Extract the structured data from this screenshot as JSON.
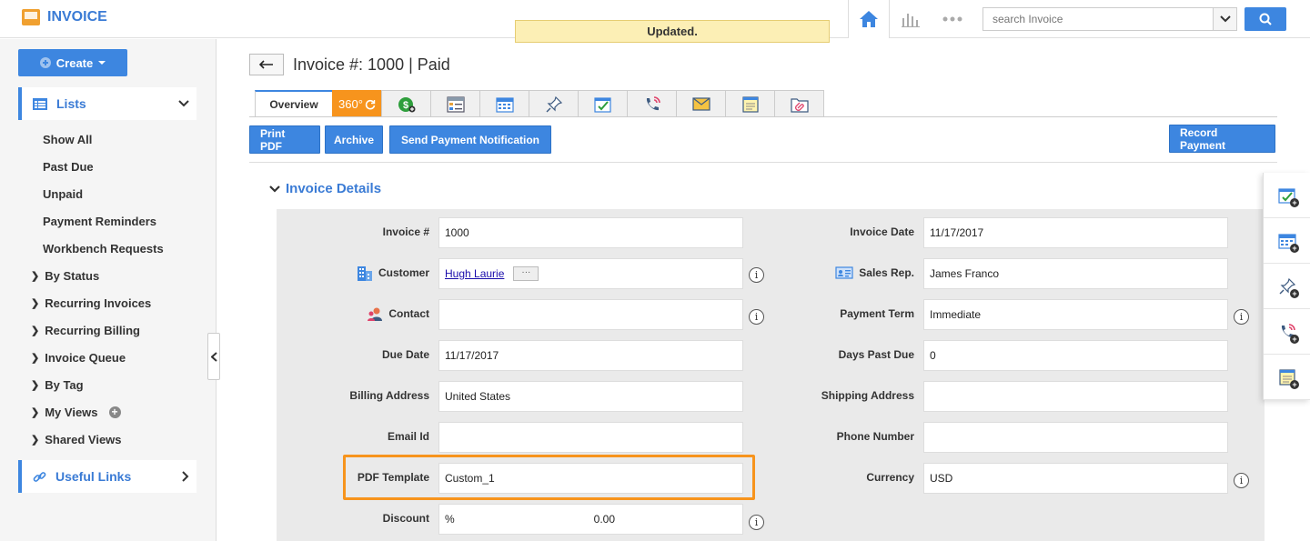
{
  "app": {
    "title": "INVOICE"
  },
  "toast": "Updated.",
  "search": {
    "placeholder": "search Invoice"
  },
  "sidebar": {
    "create_label": "Create",
    "lists_label": "Lists",
    "list_items": [
      "Show All",
      "Past Due",
      "Unpaid",
      "Payment Reminders",
      "Workbench Requests"
    ],
    "groups": [
      "By Status",
      "Recurring Invoices",
      "Recurring Billing",
      "Invoice Queue",
      "By Tag",
      "My Views",
      "Shared Views"
    ],
    "useful_links_label": "Useful Links"
  },
  "header": {
    "title": "Invoice #: 1000 | Paid"
  },
  "tabs": {
    "overview": "Overview",
    "t360": "360°"
  },
  "actions": {
    "print_pdf": "Print PDF",
    "archive": "Archive",
    "send_notification": "Send Payment Notification",
    "record_payment": "Record Payment"
  },
  "details": {
    "section_title": "Invoice Details",
    "left": [
      {
        "label": "Invoice #",
        "value": "1000"
      },
      {
        "label": "Customer",
        "value": "Hugh Laurie"
      },
      {
        "label": "Contact",
        "value": ""
      },
      {
        "label": "Due Date",
        "value": "11/17/2017"
      },
      {
        "label": "Billing Address",
        "value": "United States"
      },
      {
        "label": "Email Id",
        "value": ""
      },
      {
        "label": "PDF Template",
        "value": "Custom_1"
      },
      {
        "label": "Discount",
        "value": "%",
        "value2": "0.00"
      }
    ],
    "right": [
      {
        "label": "Invoice Date",
        "value": "11/17/2017"
      },
      {
        "label": "Sales Rep.",
        "value": "James Franco"
      },
      {
        "label": "Payment Term",
        "value": "Immediate"
      },
      {
        "label": "Days Past Due",
        "value": "0"
      },
      {
        "label": "Shipping Address",
        "value": ""
      },
      {
        "label": "Phone Number",
        "value": ""
      },
      {
        "label": "Currency",
        "value": "USD"
      }
    ],
    "more_label": "···",
    "info_glyph": "i"
  },
  "colors": {
    "accent": "#3d86e0",
    "orange": "#f7941d",
    "toast_bg": "#fcefb5"
  }
}
